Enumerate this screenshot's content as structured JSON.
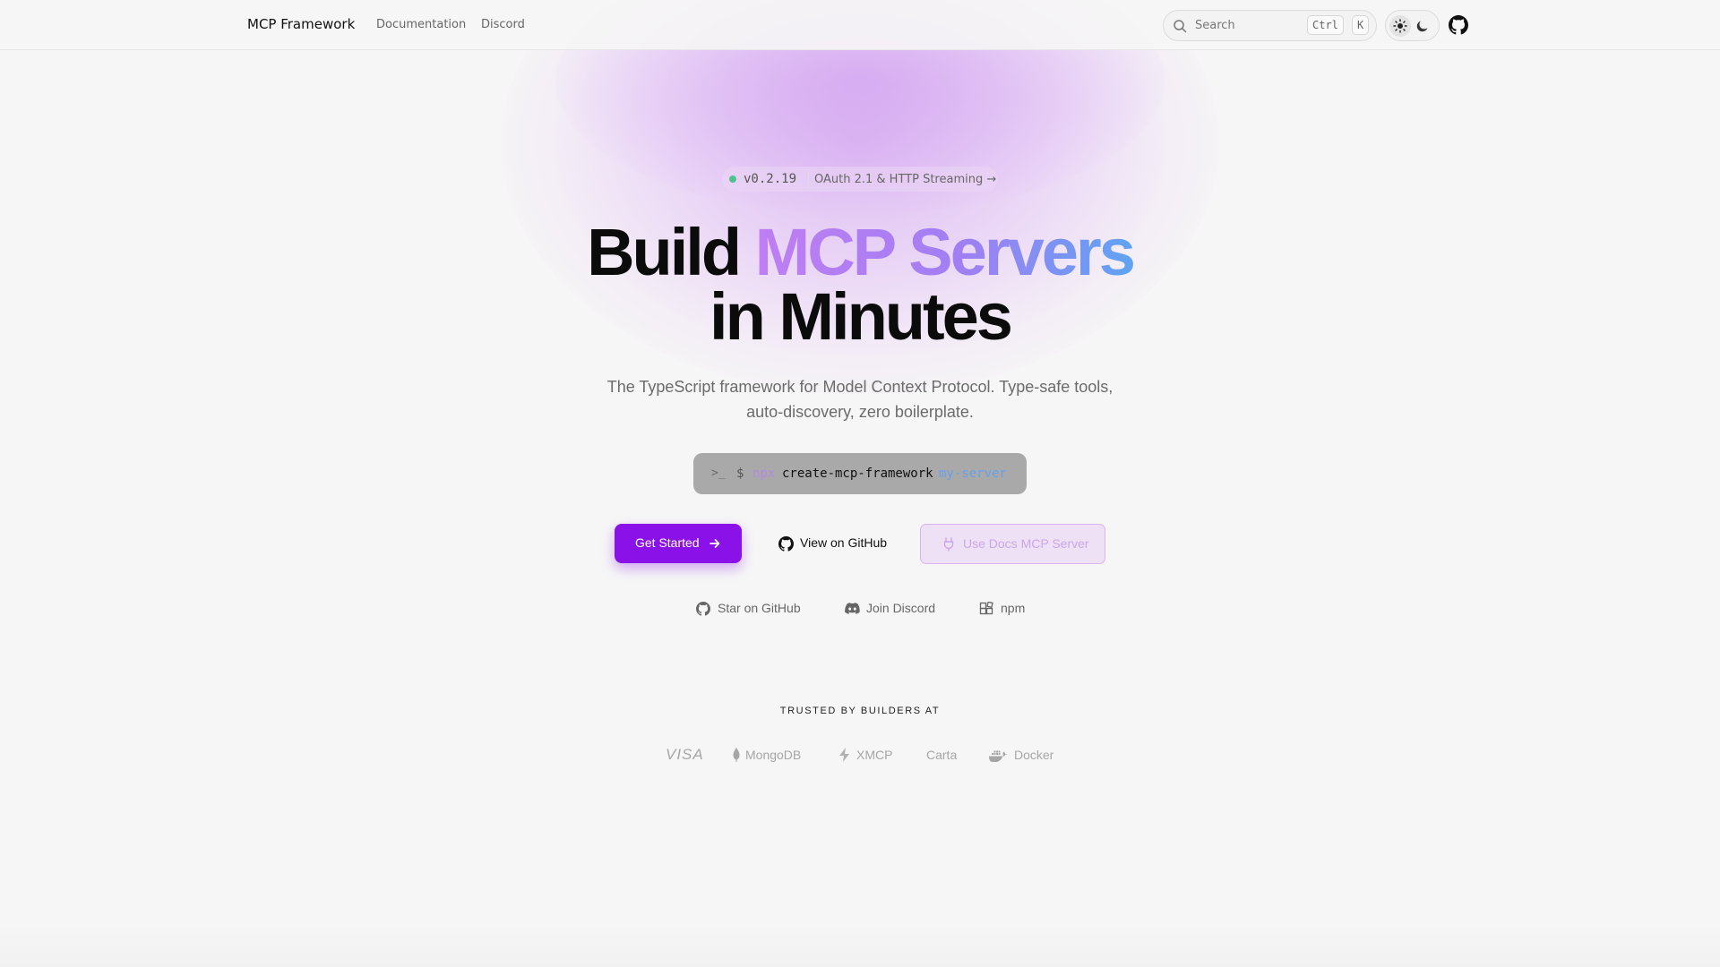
{
  "header": {
    "brand": "MCP Framework",
    "nav": {
      "docs": "Documentation",
      "discord": "Discord"
    },
    "search": {
      "placeholder": "Search",
      "shortcut_mod": "Ctrl",
      "shortcut_key": "K"
    },
    "icons": {
      "search": "search-icon",
      "sun": "sun-icon",
      "moon": "moon-icon",
      "github": "github-icon"
    }
  },
  "hero": {
    "badge": {
      "version": "v0.2.19",
      "feature": "OAuth 2.1 & HTTP Streaming",
      "arrow": "→",
      "dot_color": "#4fc18f"
    },
    "headline": {
      "plain1": "Build",
      "highlight": "MCP Servers",
      "line2": "in Minutes"
    },
    "subtitle_line1": "The TypeScript framework for Model Context Protocol. Type-safe tools,",
    "subtitle_line2": "auto-discovery, zero boilerplate.",
    "install": {
      "prompt_icon": "terminal-icon",
      "prompt": ">_",
      "dollar": "$",
      "npx": "npx",
      "command": "create-mcp-framework",
      "arg": "my-server"
    },
    "buttons": {
      "get_started": "Get Started",
      "github": "View on GitHub",
      "docs_mcp": "Use Docs MCP Server"
    },
    "links": {
      "star": "Star on GitHub",
      "discord": "Join Discord",
      "npm": "npm"
    }
  },
  "trusted": {
    "heading": "TRUSTED BY BUILDERS AT",
    "logos": [
      "VISA",
      "MongoDB",
      "XMCP",
      "Carta",
      "Docker"
    ]
  },
  "colors": {
    "accent": "#8a12e8",
    "gradient_start": "#c07ef3",
    "gradient_end": "#5fa3f3",
    "background": "#f6f6f6"
  }
}
